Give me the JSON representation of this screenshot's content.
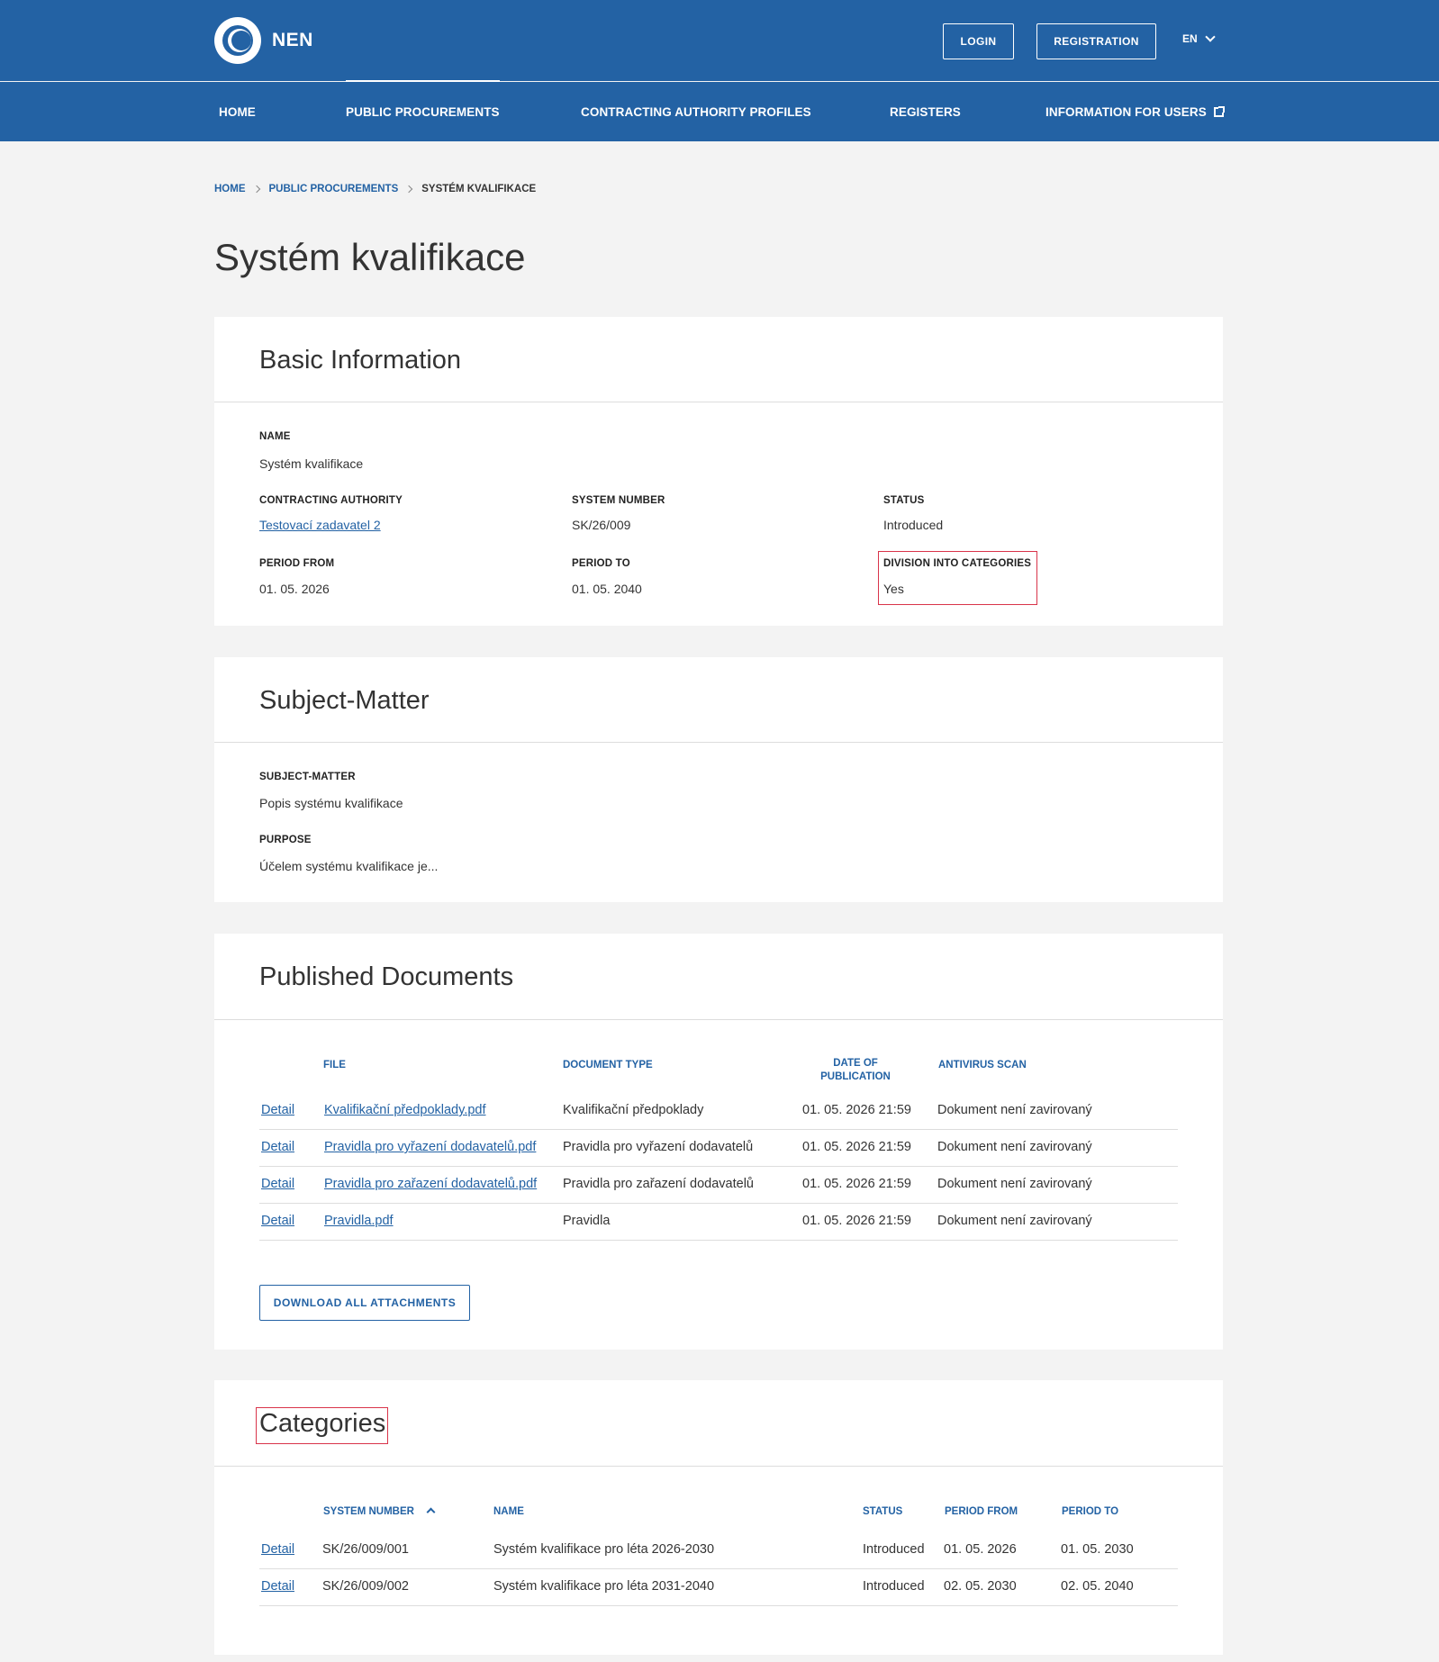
{
  "header": {
    "logo_text": "NEN",
    "login_label": "LOGIN",
    "registration_label": "REGISTRATION",
    "language": "EN"
  },
  "nav": {
    "items": [
      {
        "label": "HOME"
      },
      {
        "label": "PUBLIC PROCUREMENTS"
      },
      {
        "label": "CONTRACTING AUTHORITY PROFILES"
      },
      {
        "label": "REGISTERS"
      },
      {
        "label": "INFORMATION FOR USERS"
      }
    ]
  },
  "breadcrumb": {
    "home": "HOME",
    "public_procurements": "PUBLIC PROCUREMENTS",
    "current": "SYSTÉM KVALIFIKACE"
  },
  "page_title": "Systém kvalifikace",
  "basic_info": {
    "title": "Basic Information",
    "name_label": "NAME",
    "name_value": "Systém kvalifikace",
    "authority_label": "CONTRACTING AUTHORITY",
    "authority_value": "Testovací zadavatel 2",
    "system_number_label": "SYSTEM NUMBER",
    "system_number_value": "SK/26/009",
    "status_label": "STATUS",
    "status_value": "Introduced",
    "period_from_label": "PERIOD FROM",
    "period_from_value": "01. 05. 2026",
    "period_to_label": "PERIOD TO",
    "period_to_value": "01. 05. 2040",
    "division_label": "DIVISION INTO CATEGORIES",
    "division_value": "Yes"
  },
  "subject_matter": {
    "title": "Subject-Matter",
    "subject_label": "SUBJECT-MATTER",
    "subject_value": "Popis systému kvalifikace",
    "purpose_label": "PURPOSE",
    "purpose_value": "Účelem systému kvalifikace je..."
  },
  "documents": {
    "title": "Published Documents",
    "headers": {
      "file": "FILE",
      "document_type": "DOCUMENT TYPE",
      "date_line1": "DATE OF",
      "date_line2": "PUBLICATION",
      "antivirus": "ANTIVIRUS SCAN"
    },
    "rows": [
      {
        "detail": "Detail",
        "file": "Kvalifikační předpoklady.pdf",
        "type": "Kvalifikační předpoklady",
        "date": "01. 05. 2026 21:59",
        "scan": "Dokument není zavirovaný"
      },
      {
        "detail": "Detail",
        "file": "Pravidla pro vyřazení dodavatelů.pdf",
        "type": "Pravidla pro vyřazení dodavatelů",
        "date": "01. 05. 2026 21:59",
        "scan": "Dokument není zavirovaný"
      },
      {
        "detail": "Detail",
        "file": "Pravidla pro zařazení dodavatelů.pdf",
        "type": "Pravidla pro zařazení dodavatelů",
        "date": "01. 05. 2026 21:59",
        "scan": "Dokument není zavirovaný"
      },
      {
        "detail": "Detail",
        "file": "Pravidla.pdf",
        "type": "Pravidla",
        "date": "01. 05. 2026 21:59",
        "scan": "Dokument není zavirovaný"
      }
    ],
    "download_label": "DOWNLOAD ALL ATTACHMENTS"
  },
  "categories": {
    "title": "Categories",
    "headers": {
      "system_number": "SYSTEM NUMBER",
      "name": "NAME",
      "status": "STATUS",
      "period_from": "PERIOD FROM",
      "period_to": "PERIOD TO"
    },
    "rows": [
      {
        "detail": "Detail",
        "system_number": "SK/26/009/001",
        "name": "Systém kvalifikace pro léta 2026-2030",
        "status": "Introduced",
        "period_from": "01. 05. 2026",
        "period_to": "01. 05. 2030"
      },
      {
        "detail": "Detail",
        "system_number": "SK/26/009/002",
        "name": "Systém kvalifikace pro léta 2031-2040",
        "status": "Introduced",
        "period_from": "02. 05. 2030",
        "period_to": "02. 05. 2040"
      }
    ]
  }
}
